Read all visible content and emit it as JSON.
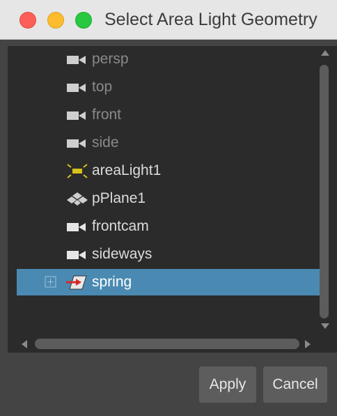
{
  "window": {
    "title": "Select Area Light Geometry"
  },
  "outliner": {
    "items": [
      {
        "label": "persp",
        "icon": "camera-icon",
        "dimmed": true
      },
      {
        "label": "top",
        "icon": "camera-icon",
        "dimmed": true
      },
      {
        "label": "front",
        "icon": "camera-icon",
        "dimmed": true
      },
      {
        "label": "side",
        "icon": "camera-icon",
        "dimmed": true
      },
      {
        "label": "areaLight1",
        "icon": "area-light-icon",
        "dimmed": false
      },
      {
        "label": "pPlane1",
        "icon": "mesh-icon",
        "dimmed": false
      },
      {
        "label": "frontcam",
        "icon": "camera-icon",
        "dimmed": false
      },
      {
        "label": "sideways",
        "icon": "camera-icon",
        "dimmed": false
      },
      {
        "label": "spring",
        "icon": "spring-icon",
        "dimmed": false,
        "selected": true,
        "expandable": true
      }
    ]
  },
  "buttons": {
    "apply": "Apply",
    "cancel": "Cancel"
  },
  "colors": {
    "selection": "#4a8ab2",
    "panel": "#2b2b2b",
    "window": "#444444"
  }
}
